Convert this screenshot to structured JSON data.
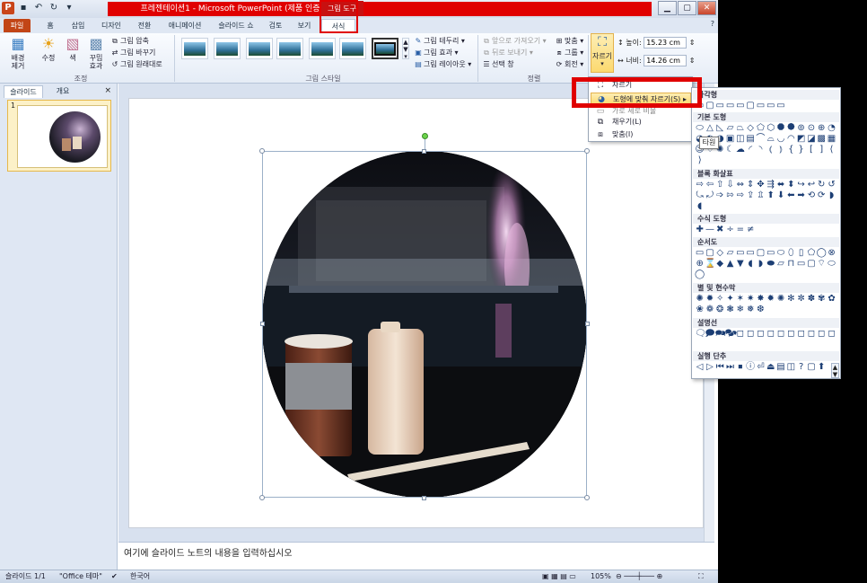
{
  "titlebar": {
    "title": "프레젠테이션1 - Microsoft PowerPoint (제품 인증 실패)",
    "context_tab": "그림 도구",
    "minimize": "▁",
    "maximize": "▢",
    "close": "✕"
  },
  "tabs": [
    "파일",
    "홈",
    "삽입",
    "디자인",
    "전환",
    "애니메이션",
    "슬라이드 쇼",
    "검토",
    "보기",
    "서식"
  ],
  "ribbon": {
    "adjust": {
      "remove_bg": "배경\n제거",
      "corrections": "수정",
      "color": "색",
      "artistic": "꾸밈\n효과",
      "compress": "그림 압축",
      "change": "그림 바꾸기",
      "reset": "그림 원래대로",
      "label": "조정"
    },
    "styles": {
      "border": "그림 테두리",
      "effects": "그림 효과",
      "layout": "그림 레이아웃",
      "label": "그림 스타일"
    },
    "arrange": {
      "forward": "앞으로 가져오기",
      "backward": "뒤로 보내기",
      "selection": "선택 창",
      "align": "맞춤",
      "group": "그룹",
      "rotate": "회전",
      "label": "정렬"
    },
    "size": {
      "crop": "자르기",
      "height_label": "높이:",
      "height": "15.23 cm",
      "width_label": "너비:",
      "width": "14.26 cm"
    }
  },
  "leftpane": {
    "tab_slides": "슬라이드",
    "tab_outline": "개요",
    "close": "×",
    "slide_number": "1"
  },
  "crop_menu": {
    "items": [
      "자르기",
      "도형에 맞춰 자르기(S)",
      "가로 세로 비율",
      "채우기(L)",
      "맞춤(I)"
    ]
  },
  "tooltip": "타원",
  "shapes": {
    "categories": [
      "사각형",
      "기본 도형",
      "블록 화살표",
      "수식 도형",
      "순서도",
      "별 및 현수막",
      "설명선",
      "실행 단추"
    ],
    "rows": [
      [
        "▭",
        "▢",
        "▭",
        "▭",
        "▭",
        "▢",
        "▭",
        "▭",
        "▭"
      ],
      [
        "⬭",
        "△",
        "◺",
        "▱",
        "⏢",
        "◇",
        "⬠",
        "⬡",
        "⯃",
        "⯄",
        "⊚",
        "⊙",
        "⊕",
        "◔",
        "◕",
        "◐",
        "◑",
        "▣",
        "◫",
        "▤",
        "⌒",
        "⌓",
        "◡",
        "◠",
        "◩",
        "◪",
        "▩",
        "▦",
        "☺",
        "♡",
        "✺",
        "☾",
        "☁",
        "◜",
        "◝",
        "⦅",
        "⦆",
        "{",
        "}",
        "[",
        "]",
        "⟨",
        "⟩"
      ],
      [
        "⇨",
        "⇦",
        "⇧",
        "⇩",
        "⇔",
        "⇕",
        "✥",
        "⇶",
        "⬌",
        "⬍",
        "↪",
        "↩",
        "↻",
        "↺",
        "⤿",
        "⤾",
        "➩",
        "⇰",
        "⇨",
        "⇪",
        "⇫",
        "⬆",
        "⬇",
        "⬅",
        "➡",
        "⟲",
        "⟳",
        "◗",
        "◖"
      ],
      [
        "✚",
        "—",
        "✖",
        "÷",
        "=",
        "≠"
      ],
      [
        "▭",
        "▢",
        "◇",
        "▱",
        "▭",
        "▭",
        "▢",
        "▭",
        "⬭",
        "⬯",
        "▯",
        "⬠",
        "◯",
        "⊗",
        "⊕",
        "⌛",
        "◆",
        "▲",
        "▼",
        "◖",
        "◗",
        "⬬",
        "⏥",
        "⊓",
        "▭",
        "▢",
        "⌔",
        "⬭",
        "◯"
      ],
      [
        "✺",
        "✹",
        "✧",
        "✦",
        "✶",
        "✷",
        "✸",
        "✹",
        "✺",
        "✻",
        "✼",
        "✽",
        "✾",
        "✿",
        "❀",
        "❁",
        "❂",
        "❃",
        "❄",
        "❅",
        "❆"
      ],
      [
        "🗨",
        "🗩",
        "🗪",
        "🗫",
        "◻",
        "◻",
        "◻",
        "◻",
        "◻",
        "◻",
        "◻",
        "◻",
        "◻",
        "◻"
      ],
      [
        "◁",
        "▷",
        "⏮",
        "⏭",
        "⏹",
        "ⓘ",
        "⏎",
        "⏏",
        "▤",
        "◫",
        "?",
        "▢",
        "⬆"
      ]
    ]
  },
  "notes": "여기에 슬라이드 노트의 내용을 입력하십시오",
  "status": {
    "slide": "슬라이드 1/1",
    "theme": "\"Office 테마\"",
    "lang": "한국어",
    "zoom": "105%"
  }
}
